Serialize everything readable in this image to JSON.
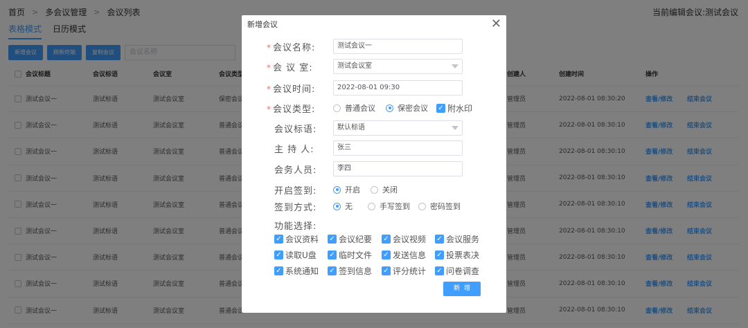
{
  "breadcrumb": [
    "首页",
    "多会议管理",
    "会议列表"
  ],
  "current_meeting": "当前编辑会议:测试会议",
  "view_modes": [
    "表格模式",
    "日历模式"
  ],
  "toolbar": {
    "add_label": "新增会议",
    "refresh_label": "刷新终端",
    "copy_label": "复制会议",
    "search_placeholder": "会议名称"
  },
  "table": {
    "columns": [
      "会议标题",
      "会议标语",
      "会议室",
      "会议类型",
      "创建人",
      "创建时间",
      "操作"
    ],
    "rows": [
      {
        "title": "测试会议一",
        "slogan": "测试标语",
        "room": "测试会议室",
        "type": "保密会议",
        "creator": "管理员",
        "created": "2022-08-01 08:30:20",
        "edit": "查看/修改",
        "end": "结束会议"
      },
      {
        "title": "测试会议一",
        "slogan": "测试标语",
        "room": "测试会议室",
        "type": "普通会议",
        "creator": "管理员",
        "created": "2022-08-01 08:30:10",
        "edit": "查看/修改",
        "end": "结束会议"
      },
      {
        "title": "测试会议一",
        "slogan": "测试标语",
        "room": "测试会议室",
        "type": "普通会议",
        "creator": "管理员",
        "created": "2022-08-01 08:30:10",
        "edit": "查看/修改",
        "end": "结束会议"
      },
      {
        "title": "测试会议一",
        "slogan": "测试标语",
        "room": "测试会议室",
        "type": "普通会议",
        "creator": "管理员",
        "created": "2022-08-01 08:30:10",
        "edit": "查看/修改",
        "end": "结束会议"
      },
      {
        "title": "测试会议一",
        "slogan": "测试标语",
        "room": "测试会议室",
        "type": "普通会议",
        "creator": "管理员",
        "created": "2022-08-01 08:30:10",
        "edit": "查看/修改",
        "end": "结束会议"
      },
      {
        "title": "测试会议一",
        "slogan": "测试标语",
        "room": "测试会议室",
        "type": "普通会议",
        "creator": "管理员",
        "created": "2022-08-01 08:30:10",
        "edit": "查看/修改",
        "end": "结束会议"
      },
      {
        "title": "测试会议一",
        "slogan": "测试标语",
        "room": "测试会议室",
        "type": "普通会议",
        "creator": "管理员",
        "created": "2022-08-01 08:30:10",
        "edit": "查看/修改",
        "end": "结束会议"
      },
      {
        "title": "测试会议一",
        "slogan": "测试标语",
        "room": "测试会议室",
        "type": "普通会议",
        "creator": "管理员",
        "created": "2022-08-01 08:30:10",
        "edit": "查看/修改",
        "end": "结束会议"
      },
      {
        "title": "测试会议一",
        "slogan": "测试标语",
        "room": "测试会议室",
        "type": "普通会议",
        "creator": "管理员",
        "created": "2022-08-01 08:30:10",
        "edit": "查看/修改",
        "end": "结束会议"
      }
    ]
  },
  "dialog": {
    "title": "新增会议",
    "close_icon": "close-icon",
    "required_mark": "*",
    "name_label": "会议名称:",
    "name_value": "测试会议一",
    "room_label": "会 议 室:",
    "room_value": "测试会议室",
    "time_label": "会议时间:",
    "time_value": "2022-08-01 09:30",
    "type_label": "会议类型:",
    "type_options": [
      "普通会议",
      "保密会议"
    ],
    "type_selected": "保密会议",
    "watermark_label": "附水印",
    "watermark_checked": true,
    "slogan_label": "会议标语:",
    "slogan_value": "默认标语",
    "host_label": "主 持 人:",
    "host_value": "张三",
    "staff_label": "会务人员:",
    "staff_value": "李四",
    "signin_label": "开启签到:",
    "signin_options": [
      "开启",
      "关闭"
    ],
    "signin_selected": "开启",
    "signin_method_label": "签到方式:",
    "signin_method_options": [
      "无",
      "手写签到",
      "密码签到"
    ],
    "signin_method_selected": "无",
    "features_label": "功能选择:",
    "features": [
      "会议资料",
      "会议纪要",
      "会议视频",
      "会议服务",
      "读取U盘",
      "临时文件",
      "发送信息",
      "投票表决",
      "系统通知",
      "签到信息",
      "评分统计",
      "问卷调查"
    ],
    "features_checked": true,
    "submit_label": "新增"
  },
  "colors": {
    "accent": "#409eff",
    "required": "#f56c6c",
    "overlay": "rgba(0,0,0,0.5)"
  }
}
